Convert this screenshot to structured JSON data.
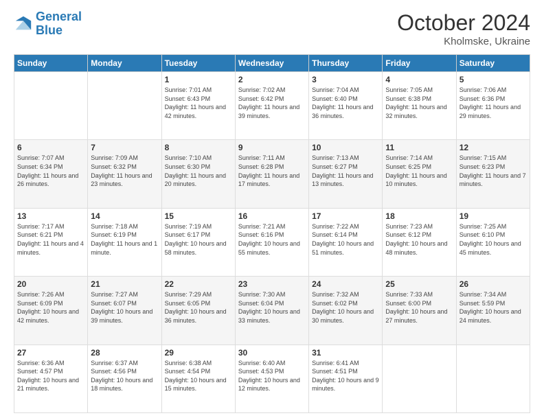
{
  "header": {
    "logo_line1": "General",
    "logo_line2": "Blue",
    "month": "October 2024",
    "location": "Kholmske, Ukraine"
  },
  "days_of_week": [
    "Sunday",
    "Monday",
    "Tuesday",
    "Wednesday",
    "Thursday",
    "Friday",
    "Saturday"
  ],
  "weeks": [
    [
      {
        "num": "",
        "info": ""
      },
      {
        "num": "",
        "info": ""
      },
      {
        "num": "1",
        "info": "Sunrise: 7:01 AM\nSunset: 6:43 PM\nDaylight: 11 hours and 42 minutes."
      },
      {
        "num": "2",
        "info": "Sunrise: 7:02 AM\nSunset: 6:42 PM\nDaylight: 11 hours and 39 minutes."
      },
      {
        "num": "3",
        "info": "Sunrise: 7:04 AM\nSunset: 6:40 PM\nDaylight: 11 hours and 36 minutes."
      },
      {
        "num": "4",
        "info": "Sunrise: 7:05 AM\nSunset: 6:38 PM\nDaylight: 11 hours and 32 minutes."
      },
      {
        "num": "5",
        "info": "Sunrise: 7:06 AM\nSunset: 6:36 PM\nDaylight: 11 hours and 29 minutes."
      }
    ],
    [
      {
        "num": "6",
        "info": "Sunrise: 7:07 AM\nSunset: 6:34 PM\nDaylight: 11 hours and 26 minutes."
      },
      {
        "num": "7",
        "info": "Sunrise: 7:09 AM\nSunset: 6:32 PM\nDaylight: 11 hours and 23 minutes."
      },
      {
        "num": "8",
        "info": "Sunrise: 7:10 AM\nSunset: 6:30 PM\nDaylight: 11 hours and 20 minutes."
      },
      {
        "num": "9",
        "info": "Sunrise: 7:11 AM\nSunset: 6:28 PM\nDaylight: 11 hours and 17 minutes."
      },
      {
        "num": "10",
        "info": "Sunrise: 7:13 AM\nSunset: 6:27 PM\nDaylight: 11 hours and 13 minutes."
      },
      {
        "num": "11",
        "info": "Sunrise: 7:14 AM\nSunset: 6:25 PM\nDaylight: 11 hours and 10 minutes."
      },
      {
        "num": "12",
        "info": "Sunrise: 7:15 AM\nSunset: 6:23 PM\nDaylight: 11 hours and 7 minutes."
      }
    ],
    [
      {
        "num": "13",
        "info": "Sunrise: 7:17 AM\nSunset: 6:21 PM\nDaylight: 11 hours and 4 minutes."
      },
      {
        "num": "14",
        "info": "Sunrise: 7:18 AM\nSunset: 6:19 PM\nDaylight: 11 hours and 1 minute."
      },
      {
        "num": "15",
        "info": "Sunrise: 7:19 AM\nSunset: 6:17 PM\nDaylight: 10 hours and 58 minutes."
      },
      {
        "num": "16",
        "info": "Sunrise: 7:21 AM\nSunset: 6:16 PM\nDaylight: 10 hours and 55 minutes."
      },
      {
        "num": "17",
        "info": "Sunrise: 7:22 AM\nSunset: 6:14 PM\nDaylight: 10 hours and 51 minutes."
      },
      {
        "num": "18",
        "info": "Sunrise: 7:23 AM\nSunset: 6:12 PM\nDaylight: 10 hours and 48 minutes."
      },
      {
        "num": "19",
        "info": "Sunrise: 7:25 AM\nSunset: 6:10 PM\nDaylight: 10 hours and 45 minutes."
      }
    ],
    [
      {
        "num": "20",
        "info": "Sunrise: 7:26 AM\nSunset: 6:09 PM\nDaylight: 10 hours and 42 minutes."
      },
      {
        "num": "21",
        "info": "Sunrise: 7:27 AM\nSunset: 6:07 PM\nDaylight: 10 hours and 39 minutes."
      },
      {
        "num": "22",
        "info": "Sunrise: 7:29 AM\nSunset: 6:05 PM\nDaylight: 10 hours and 36 minutes."
      },
      {
        "num": "23",
        "info": "Sunrise: 7:30 AM\nSunset: 6:04 PM\nDaylight: 10 hours and 33 minutes."
      },
      {
        "num": "24",
        "info": "Sunrise: 7:32 AM\nSunset: 6:02 PM\nDaylight: 10 hours and 30 minutes."
      },
      {
        "num": "25",
        "info": "Sunrise: 7:33 AM\nSunset: 6:00 PM\nDaylight: 10 hours and 27 minutes."
      },
      {
        "num": "26",
        "info": "Sunrise: 7:34 AM\nSunset: 5:59 PM\nDaylight: 10 hours and 24 minutes."
      }
    ],
    [
      {
        "num": "27",
        "info": "Sunrise: 6:36 AM\nSunset: 4:57 PM\nDaylight: 10 hours and 21 minutes."
      },
      {
        "num": "28",
        "info": "Sunrise: 6:37 AM\nSunset: 4:56 PM\nDaylight: 10 hours and 18 minutes."
      },
      {
        "num": "29",
        "info": "Sunrise: 6:38 AM\nSunset: 4:54 PM\nDaylight: 10 hours and 15 minutes."
      },
      {
        "num": "30",
        "info": "Sunrise: 6:40 AM\nSunset: 4:53 PM\nDaylight: 10 hours and 12 minutes."
      },
      {
        "num": "31",
        "info": "Sunrise: 6:41 AM\nSunset: 4:51 PM\nDaylight: 10 hours and 9 minutes."
      },
      {
        "num": "",
        "info": ""
      },
      {
        "num": "",
        "info": ""
      }
    ]
  ]
}
